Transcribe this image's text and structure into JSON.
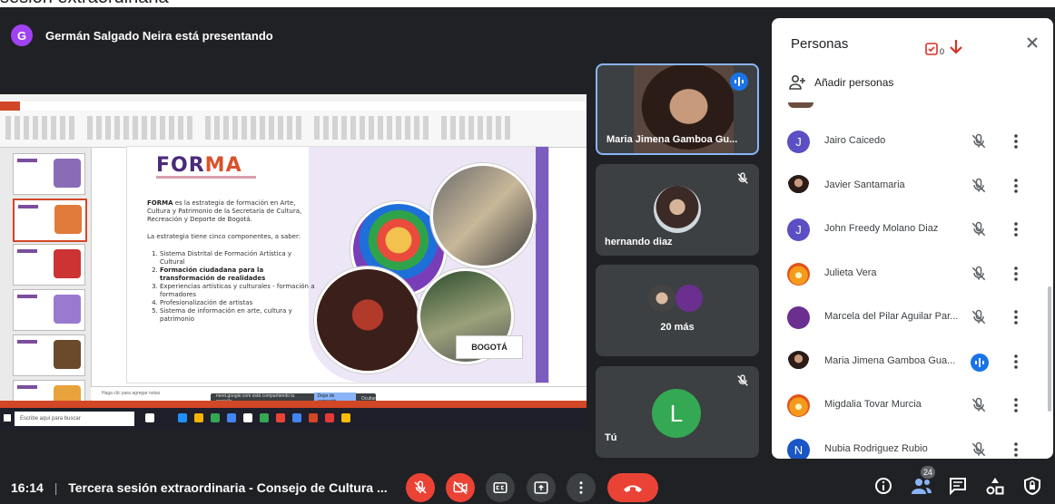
{
  "top_strip_text": "sesión extraordinaria",
  "presenter": {
    "initial": "G",
    "text": "Germán Salgado Neira está presentando"
  },
  "slide": {
    "logo_a": "FOR",
    "logo_b": "MA",
    "p1_bold": "FORMA",
    "p1_rest": " es la estrategia de formación en Arte, Cultura y Patrimonio de la Secretaría de Cultura, Recreación y Deporte de Bogotá.",
    "p2": "La estrategia tiene cinco componentes, a saber:",
    "items": [
      "Sistema Distrital de Formación Artística y Cultural",
      "Formación ciudadana para la transformación de realidades",
      "Experiencias artísticas y culturales - formación a formadores",
      "Profesionalización de artistas",
      "Sistema de información en arte, cultura y patrimonio"
    ],
    "bogota": "BOGOTÁ",
    "notes": "Haga clic para agregar notas",
    "share_text": "meet.google.com está compartiendo tu pantalla.",
    "share_stop": "Dejar de compartir",
    "share_hide": "Ocultar",
    "search_placeholder": "Escribe aquí para buscar"
  },
  "tiles": {
    "t1_name": "Maria Jimena Gamboa Gu...",
    "t2_name": "hernando diaz",
    "t3_name": "20 más",
    "t4_initial": "L",
    "t4_name": "Tú"
  },
  "panel": {
    "title": "Personas",
    "badge_count": "0",
    "add_people": "Añadir personas",
    "people": [
      {
        "name": "Jairo Caicedo",
        "initial": "J",
        "color": "#5c4fc4",
        "speaking": false
      },
      {
        "name": "Javier Santamaria",
        "initial": "",
        "color": "#ffffff",
        "speaking": false
      },
      {
        "name": "John Freedy Molano Diaz",
        "initial": "J",
        "color": "#5c4fc4",
        "speaking": false
      },
      {
        "name": "Julieta Vera",
        "initial": "",
        "color": "#f59b1c",
        "speaking": false
      },
      {
        "name": "Marcela del Pilar Aguilar Par...",
        "initial": "",
        "color": "#6a2f8f",
        "speaking": false
      },
      {
        "name": "Maria Jimena Gamboa Gua...",
        "initial": "",
        "color": "#ffffff",
        "speaking": true
      },
      {
        "name": "Migdalia Tovar Murcia",
        "initial": "",
        "color": "#f59b1c",
        "speaking": false
      },
      {
        "name": "Nubia Rodriguez Rubio",
        "initial": "N",
        "color": "#1a56c4",
        "speaking": false
      }
    ]
  },
  "bottom": {
    "time": "16:14",
    "meeting_title": "Tercera sesión extraordinaria - Consejo de Cultura ...",
    "participant_count": "24"
  },
  "colors": {
    "red": "#ea4335",
    "blue": "#1a73e8",
    "bg": "#202124"
  }
}
